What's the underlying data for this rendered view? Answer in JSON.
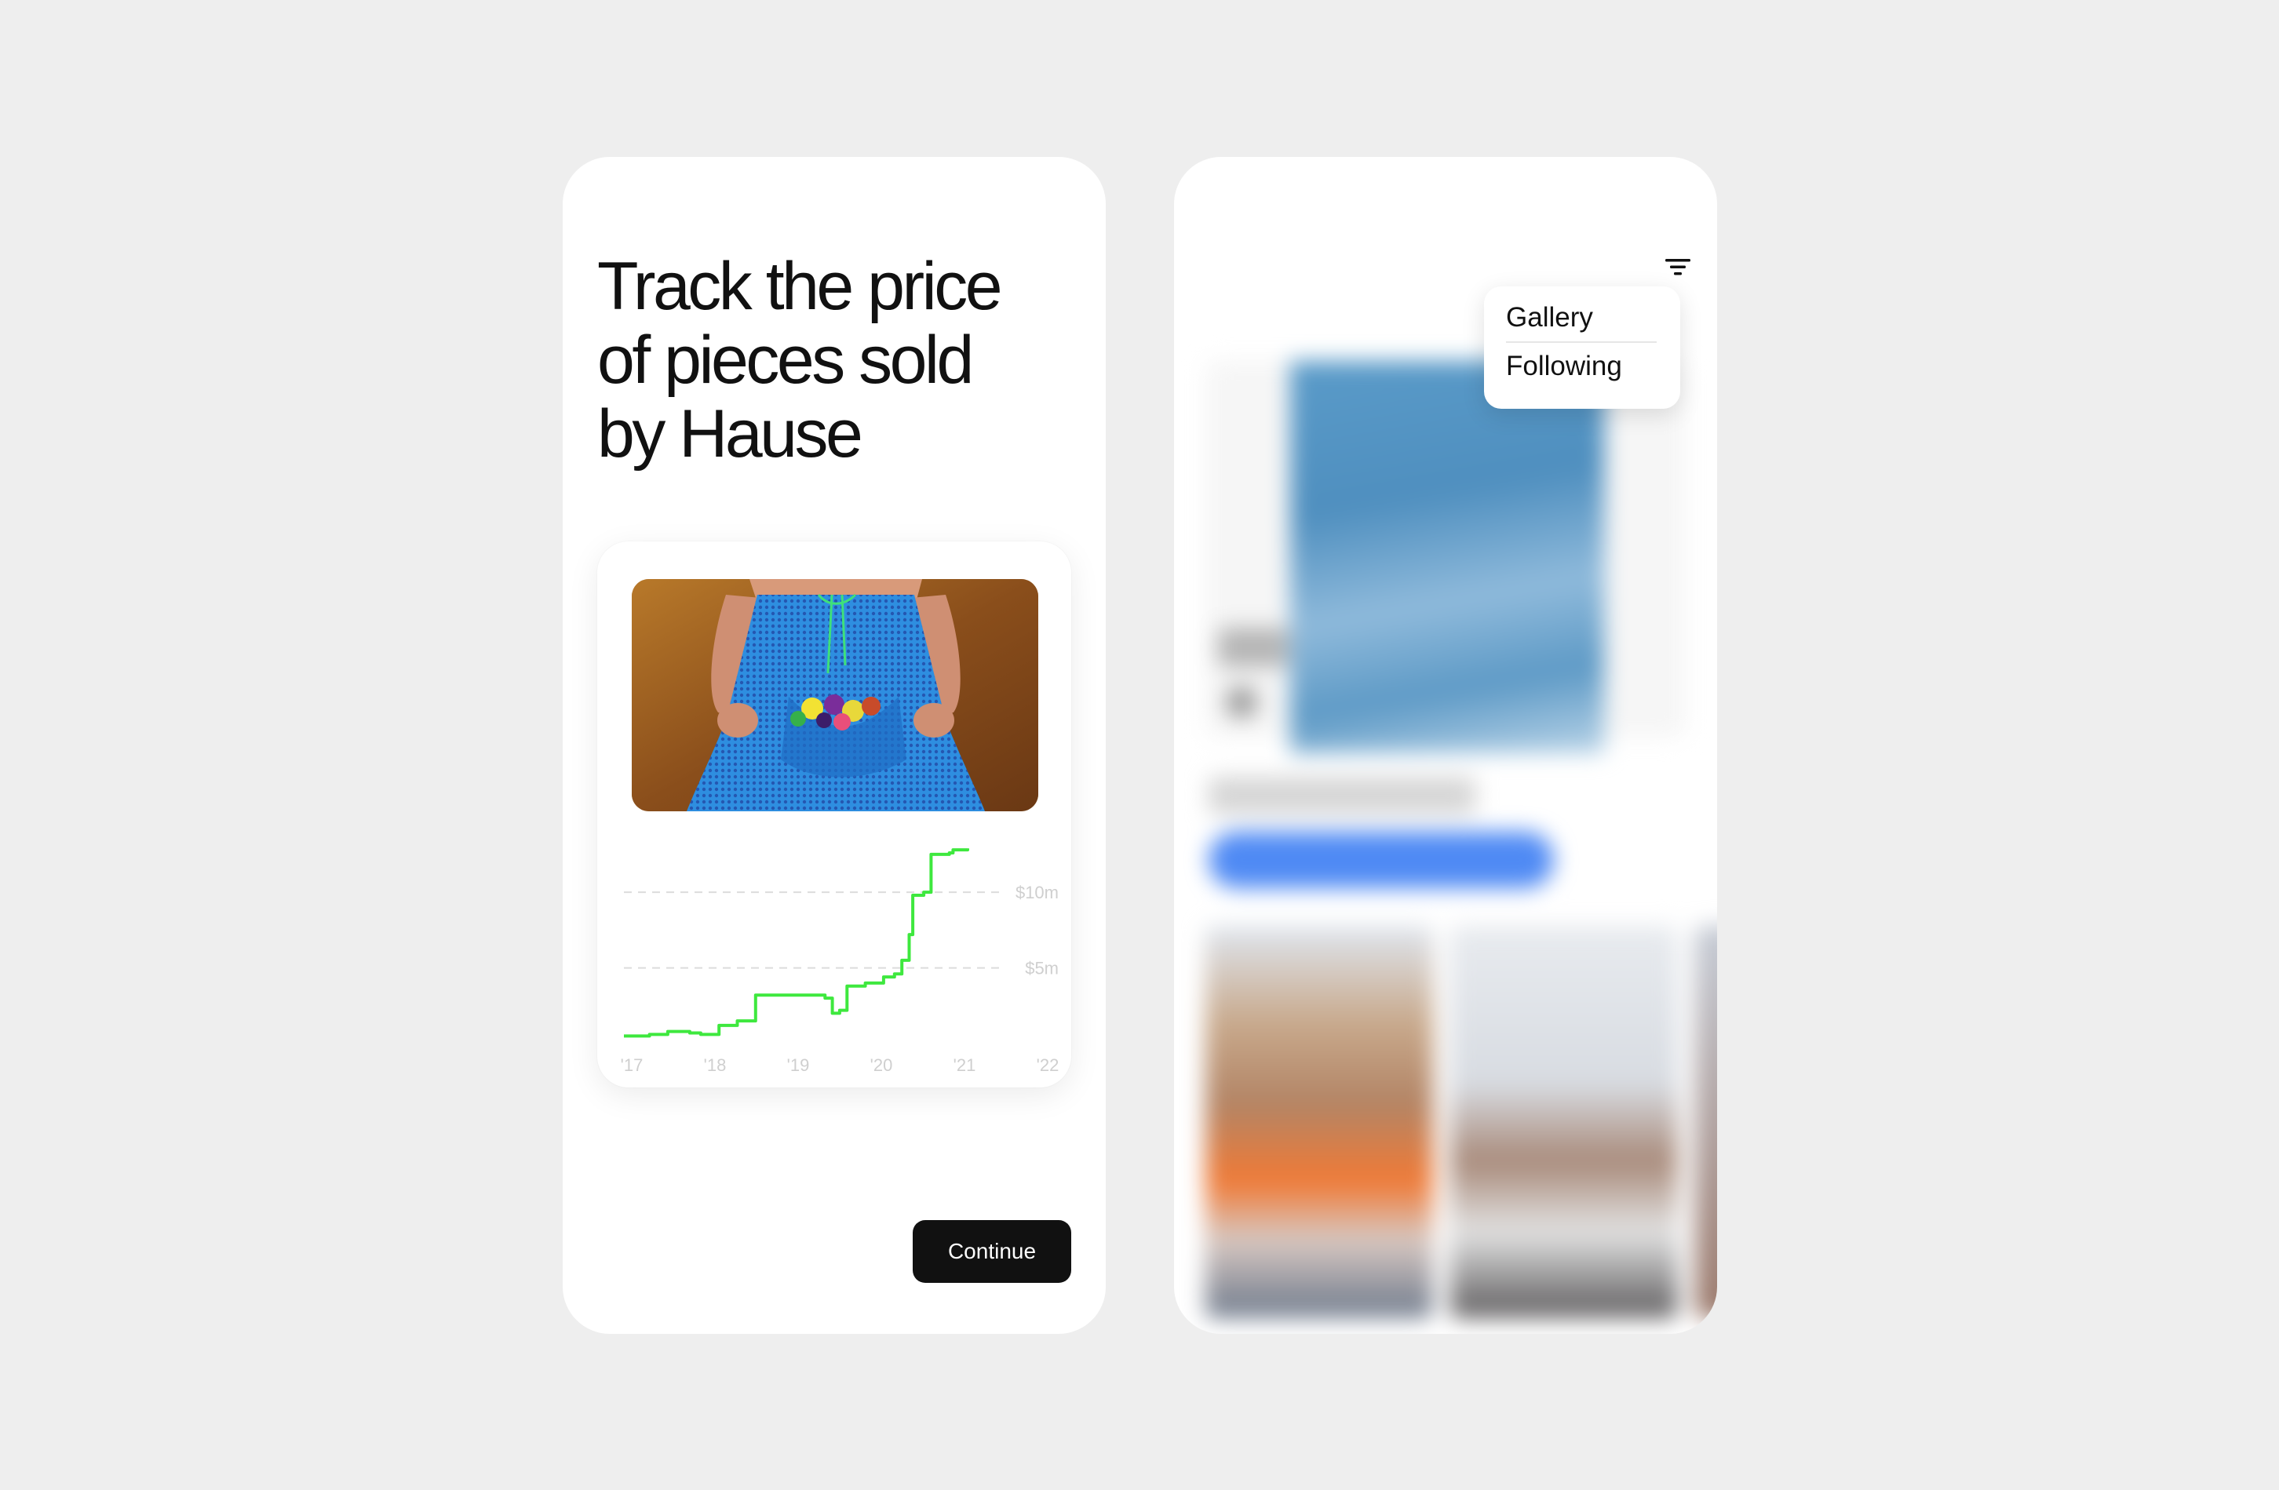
{
  "onboarding": {
    "headline_lines": [
      "Track the price",
      "of pieces sold",
      "by Hause"
    ],
    "continue_label": "Continue"
  },
  "chart_data": {
    "type": "line",
    "x_tick_labels": [
      "'17",
      "'18",
      "'19",
      "'20",
      "'21",
      "'22"
    ],
    "y_tick_labels": [
      "$10m",
      "$5m"
    ],
    "y_ticks_values": [
      10,
      5
    ],
    "unit": "$m",
    "ylim": [
      0,
      14
    ],
    "xlim": [
      2017,
      2022
    ],
    "grid": "dashed horizontal at $5m and $10m",
    "line_color": "#3ee83e",
    "points": [
      [
        2017.0,
        0.5
      ],
      [
        2017.35,
        0.6
      ],
      [
        2017.6,
        0.8
      ],
      [
        2017.9,
        0.7
      ],
      [
        2018.05,
        0.6
      ],
      [
        2018.3,
        1.2
      ],
      [
        2018.55,
        1.5
      ],
      [
        2018.8,
        3.2
      ],
      [
        2019.2,
        3.2
      ],
      [
        2019.55,
        3.2
      ],
      [
        2019.75,
        3.0
      ],
      [
        2019.85,
        2.0
      ],
      [
        2019.95,
        2.2
      ],
      [
        2020.05,
        3.8
      ],
      [
        2020.3,
        4.0
      ],
      [
        2020.55,
        4.4
      ],
      [
        2020.7,
        4.6
      ],
      [
        2020.8,
        5.5
      ],
      [
        2020.9,
        7.2
      ],
      [
        2020.95,
        9.8
      ],
      [
        2021.1,
        10.0
      ],
      [
        2021.2,
        12.5
      ],
      [
        2021.45,
        12.6
      ],
      [
        2021.5,
        12.8
      ],
      [
        2021.7,
        12.9
      ]
    ]
  },
  "gallery": {
    "filter_icon": "filter-icon",
    "dropdown_options": [
      "Gallery",
      "Following"
    ]
  }
}
